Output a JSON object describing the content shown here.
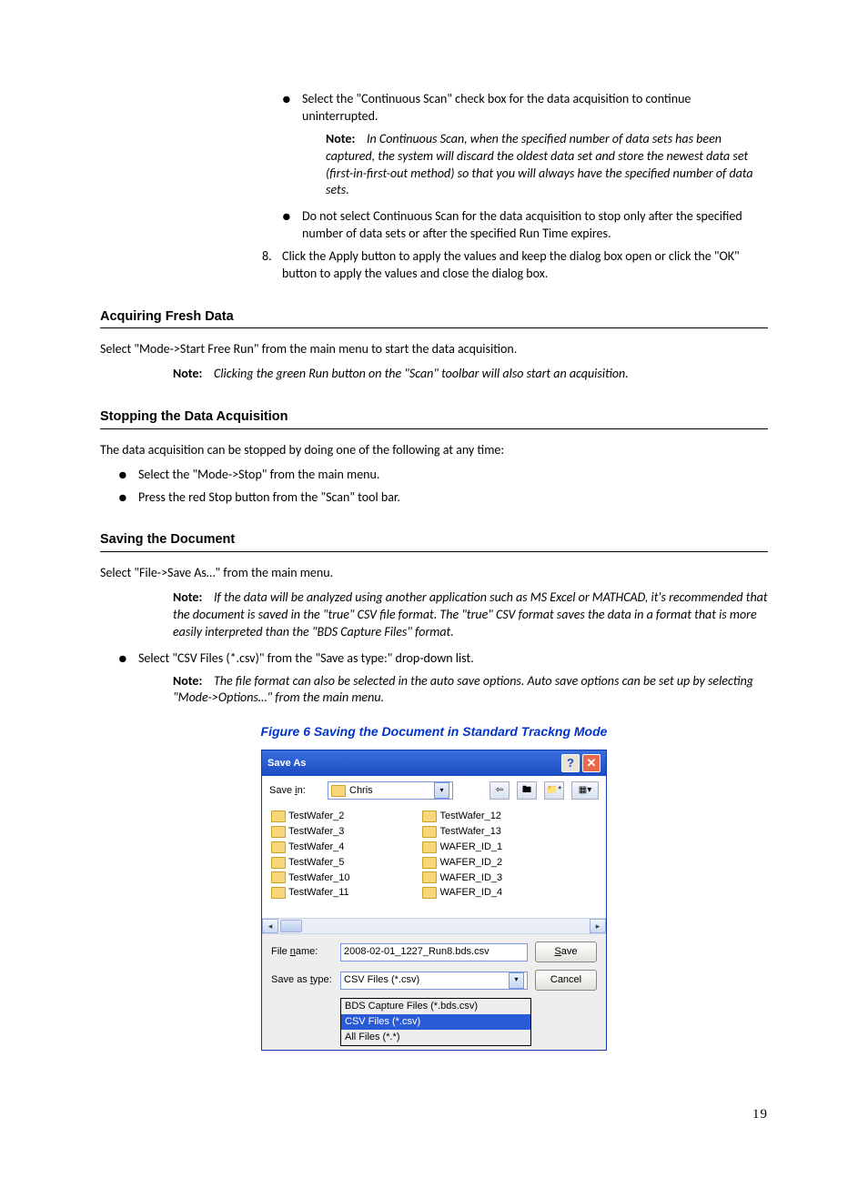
{
  "bullets": {
    "b1": "Select the \"Continuous Scan\" check box for the data acquisition to continue uninterrupted.",
    "b2": "Do not select Continuous Scan for the data acquisition to stop only after the specified number of data sets or after the specified Run Time expires.",
    "b3": "Select the \"Mode->Stop\" from the main menu.",
    "b4": "Press the red Stop button from the \"Scan\" tool bar.",
    "b5": "Select \"CSV Files (*.csv)\" from the \"Save as type:\" drop-down list."
  },
  "notes": {
    "label": "Note:",
    "n1": "In Continuous Scan, when the specified number of data sets has been captured, the system will discard the oldest data set and store the newest data set (first-in-first-out method) so that you will always have the specified number of data sets.",
    "n2": "Clicking the green Run button on the \"Scan\" toolbar will also start an acquisition.",
    "n3": "If the data will be analyzed using another application such as MS Excel or MATHCAD, it's recommended that the document is saved in the \"true\" CSV file format. The \"true\" CSV format saves the data in a format that is more easily interpreted than the \"BDS Capture Files\" format.",
    "n4": "The file format can also be selected in the auto save options. Auto save options can be set up by selecting \"Mode->Options…\" from the main menu."
  },
  "numbered": {
    "num": "8.",
    "text": "Click the Apply button to apply the values and keep the dialog box open or click the \"OK\" button to apply the values and close the dialog box."
  },
  "sections": {
    "s1": "Acquiring Fresh Data",
    "s1body": "Select \"Mode->Start Free Run\" from the main menu to start the data acquisition.",
    "s2": "Stopping the Data Acquisition",
    "s2body": "The data acquisition can be stopped by doing one of the following at any time:",
    "s3": "Saving the Document",
    "s3body": "Select \"File->Save As…\" from the main menu."
  },
  "figure": {
    "caption": "Figure 6    Saving the Document in Standard Trackng Mode"
  },
  "dialog": {
    "title": "Save As",
    "savein_label": "Save in:",
    "savein_value": "Chris",
    "files_left": [
      "TestWafer_2",
      "TestWafer_3",
      "TestWafer_4",
      "TestWafer_5",
      "TestWafer_10",
      "TestWafer_11"
    ],
    "files_right": [
      "TestWafer_12",
      "TestWafer_13",
      "WAFER_ID_1",
      "WAFER_ID_2",
      "WAFER_ID_3",
      "WAFER_ID_4"
    ],
    "filename_label_pre": "File ",
    "filename_label_u": "n",
    "filename_label_post": "ame:",
    "filename_value": "2008-02-01_1227_Run8.bds.csv",
    "savetype_label_pre": "Save as ",
    "savetype_label_u": "t",
    "savetype_label_post": "ype:",
    "savetype_value": "CSV Files (*.csv)",
    "save_btn_u": "S",
    "save_btn_rest": "ave",
    "cancel_btn": "Cancel",
    "dd_items": [
      "BDS Capture Files (*.bds.csv)",
      "CSV Files (*.csv)",
      "All Files (*.*)"
    ]
  },
  "page_number": "19"
}
